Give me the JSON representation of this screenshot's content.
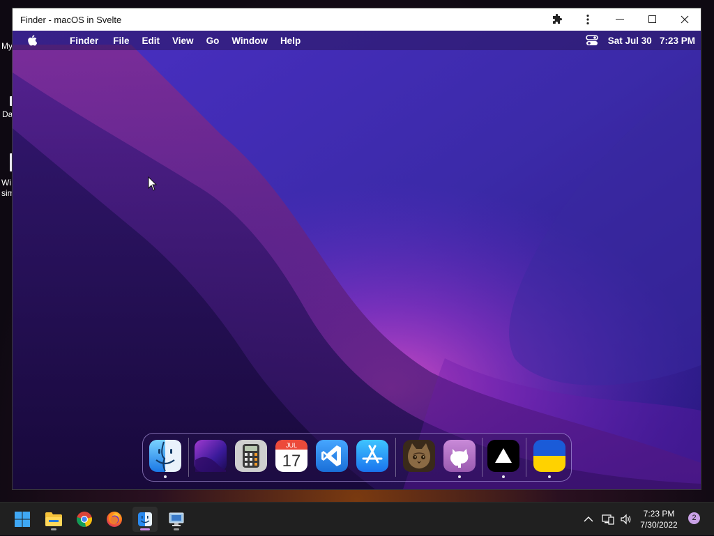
{
  "desktop": {
    "labels": [
      {
        "text": "My"
      },
      {
        "text": "Da"
      },
      {
        "text": "Wi"
      },
      {
        "text": "sim"
      }
    ]
  },
  "window": {
    "title": "Finder - macOS in Svelte",
    "icons": {
      "extension": "puzzle-piece-icon",
      "menu": "more-vertical-icon",
      "minimize": "minimize-icon",
      "maximize": "maximize-icon",
      "close": "close-icon"
    }
  },
  "menubar": {
    "apple_icon": "apple-logo-icon",
    "app_name": "Finder",
    "items": [
      "File",
      "Edit",
      "View",
      "Go",
      "Window",
      "Help"
    ],
    "control_center_icon": "control-center-icon",
    "clock": "Sat Jul 30   7:23 PM"
  },
  "dock": {
    "apps": [
      {
        "name": "Finder",
        "icon": "finder-icon",
        "running": true
      },
      {
        "name": "Wallpapers",
        "icon": "wallpaper-icon",
        "running": false
      },
      {
        "name": "Calculator",
        "icon": "calculator-icon",
        "running": false
      },
      {
        "name": "Calendar",
        "icon": "calendar-icon",
        "month": "JUL",
        "day": "17",
        "running": false
      },
      {
        "name": "VS Code",
        "icon": "vscode-icon",
        "running": false
      },
      {
        "name": "App Store",
        "icon": "app-store-icon",
        "running": false
      },
      {
        "name": "Purr",
        "icon": "cat-icon",
        "running": false
      },
      {
        "name": "GitHub",
        "icon": "github-icon",
        "running": true
      },
      {
        "name": "Vercel",
        "icon": "vercel-triangle-icon",
        "running": true
      },
      {
        "name": "Ukraine",
        "icon": "ukraine-flag-icon",
        "running": true
      }
    ]
  },
  "taskbar": {
    "apps": [
      {
        "name": "Start",
        "icon": "windows-start-icon"
      },
      {
        "name": "File Explorer",
        "icon": "folder-icon"
      },
      {
        "name": "Chrome",
        "icon": "chrome-icon"
      },
      {
        "name": "Firefox",
        "icon": "firefox-icon"
      },
      {
        "name": "macOS in Svelte",
        "icon": "finder-icon"
      },
      {
        "name": "Remote Desktop",
        "icon": "remote-desktop-icon"
      }
    ],
    "tray": {
      "time": "7:23 PM",
      "date": "7/30/2022",
      "notifications": "2"
    }
  },
  "colors": {
    "accent": "#cf8ce8",
    "menubar_text": "#ffffff",
    "taskbar_bg": "#202020"
  }
}
